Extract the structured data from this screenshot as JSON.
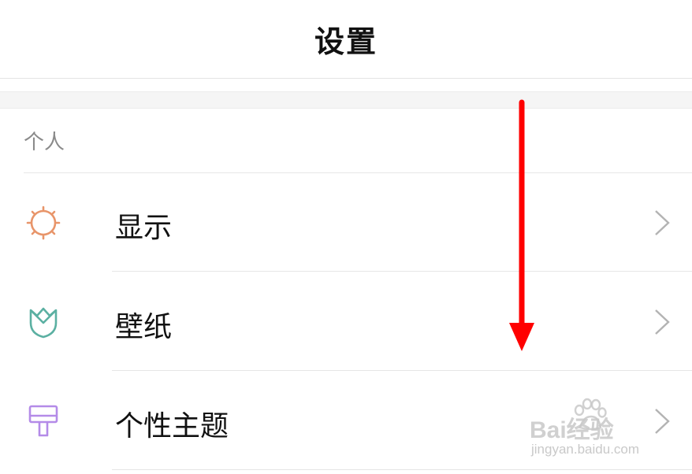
{
  "header": {
    "title": "设置"
  },
  "section": {
    "title": "个人"
  },
  "items": [
    {
      "label": "显示",
      "icon": "display-brightness-icon",
      "icon_color": "#e8956a"
    },
    {
      "label": "壁纸",
      "icon": "wallpaper-tulip-icon",
      "icon_color": "#5bb0a2"
    },
    {
      "label": "个性主题",
      "icon": "theme-brush-icon",
      "icon_color": "#b48be8"
    }
  ],
  "annotation": {
    "arrow_color": "#ff0000",
    "direction": "down"
  },
  "watermark": {
    "brand": "Bai经验",
    "url": "jingyan.baidu.com"
  }
}
